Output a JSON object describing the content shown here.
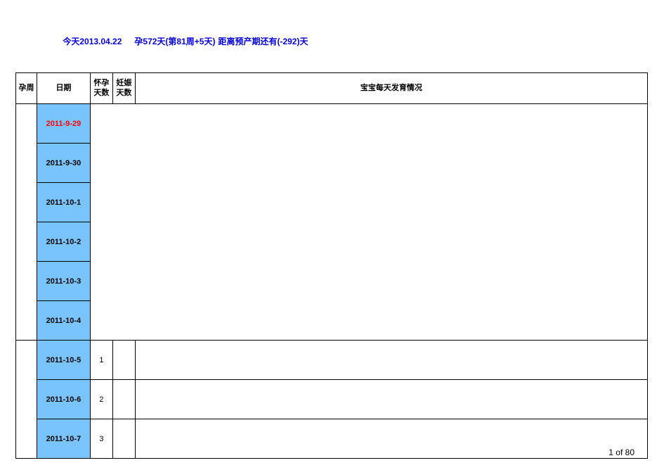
{
  "title": {
    "part1": "今天2013.04.22",
    "part2": "孕572天(第81周+5天)",
    "part3": "距离预产期还有(-292)天"
  },
  "headers": {
    "week": "孕周",
    "date": "日期",
    "preg_days_l1": "怀孕",
    "preg_days_l2": "天数",
    "gest_days_l1": "妊娠",
    "gest_days_l2": "天数",
    "desc": "宝宝每天发育情况"
  },
  "rows": [
    {
      "date": "2011-9-29",
      "preg": "",
      "gest": "",
      "desc": "",
      "highlight": true
    },
    {
      "date": "2011-9-30",
      "preg": "",
      "gest": "",
      "desc": "",
      "highlight": false
    },
    {
      "date": "2011-10-1",
      "preg": "",
      "gest": "",
      "desc": "",
      "highlight": false
    },
    {
      "date": "2011-10-2",
      "preg": "",
      "gest": "",
      "desc": "",
      "highlight": false
    },
    {
      "date": "2011-10-3",
      "preg": "",
      "gest": "",
      "desc": "",
      "highlight": false
    },
    {
      "date": "2011-10-4",
      "preg": "",
      "gest": "",
      "desc": "",
      "highlight": false
    },
    {
      "date": "2011-10-5",
      "preg": "1",
      "gest": "",
      "desc": "",
      "highlight": false
    },
    {
      "date": "2011-10-6",
      "preg": "2",
      "gest": "",
      "desc": "",
      "highlight": false
    },
    {
      "date": "2011-10-7",
      "preg": "3",
      "gest": "",
      "desc": "",
      "highlight": false
    }
  ],
  "footer": "1 of 80"
}
